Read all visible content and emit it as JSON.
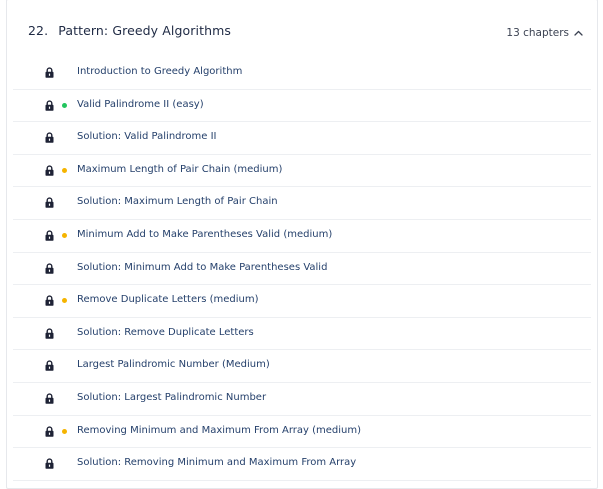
{
  "section": {
    "number": "22.",
    "title": "Pattern: Greedy Algorithms",
    "chapter_count": "13 chapters",
    "toggle_icon": "chevron-up-icon"
  },
  "colors": {
    "easy": "#22c55e",
    "medium": "#f5b400",
    "lock": "#1e2235",
    "link": "#25406b"
  },
  "chapters": [
    {
      "label": "Introduction to Greedy Algorithm",
      "difficulty": "none"
    },
    {
      "label": "Valid Palindrome II (easy)",
      "difficulty": "easy"
    },
    {
      "label": "Solution: Valid Palindrome II",
      "difficulty": "none"
    },
    {
      "label": "Maximum Length of Pair Chain (medium)",
      "difficulty": "medium"
    },
    {
      "label": "Solution: Maximum Length of Pair Chain",
      "difficulty": "none"
    },
    {
      "label": "Minimum Add to Make Parentheses Valid (medium)",
      "difficulty": "medium"
    },
    {
      "label": "Solution: Minimum Add to Make Parentheses Valid",
      "difficulty": "none"
    },
    {
      "label": "Remove Duplicate Letters (medium)",
      "difficulty": "medium"
    },
    {
      "label": "Solution: Remove Duplicate Letters",
      "difficulty": "none"
    },
    {
      "label": "Largest Palindromic Number (Medium)",
      "difficulty": "none"
    },
    {
      "label": "Solution: Largest Palindromic Number",
      "difficulty": "none"
    },
    {
      "label": "Removing Minimum and Maximum From Array (medium)",
      "difficulty": "medium"
    },
    {
      "label": "Solution: Removing Minimum and Maximum From Array",
      "difficulty": "none"
    }
  ]
}
